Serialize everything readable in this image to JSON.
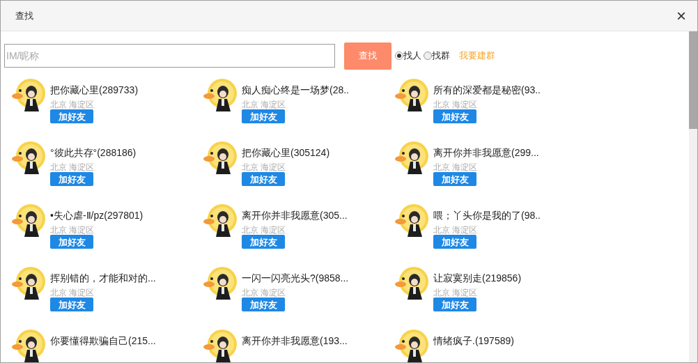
{
  "window": {
    "title": "查找",
    "close": "×"
  },
  "search": {
    "placeholder": "IM/昵称",
    "button": "查找"
  },
  "modes": [
    {
      "label": "找人",
      "selected": true
    },
    {
      "label": "找群",
      "selected": false
    }
  ],
  "create_group_link": "我要建群",
  "users": [
    {
      "name": "把你藏心里(289733)",
      "location": "北京 海淀区",
      "action": "加好友"
    },
    {
      "name": "痴人痴心终是一场梦(28..",
      "location": "北京 海淀区",
      "action": "加好友"
    },
    {
      "name": "所有的深爱都是秘密(93..",
      "location": "北京 海淀区",
      "action": "加好友"
    },
    {
      "name": "°彼此共存°(288186)",
      "location": "北京 海淀区",
      "action": "加好友"
    },
    {
      "name": "把你藏心里(305124)",
      "location": "北京 海淀区",
      "action": "加好友"
    },
    {
      "name": "离开你并非我愿意(299...",
      "location": "北京 海淀区",
      "action": "加好友"
    },
    {
      "name": "•失心虐-Ⅱ/pz(297801)",
      "location": "北京 海淀区",
      "action": "加好友"
    },
    {
      "name": "离开你并非我愿意(305...",
      "location": "北京 海淀区",
      "action": "加好友"
    },
    {
      "name": "喂；丫头你是我的了(98..",
      "location": "北京 海淀区",
      "action": "加好友"
    },
    {
      "name": "挥别错的，才能和对的...",
      "location": "北京 海淀区",
      "action": "加好友"
    },
    {
      "name": "一闪一闪亮光头?(9858...",
      "location": "北京 海淀区",
      "action": "加好友"
    },
    {
      "name": "让寂寞别走(219856)",
      "location": "北京 海淀区",
      "action": "加好友"
    },
    {
      "name": "你要懂得欺骗自己(215..."
    },
    {
      "name": "离开你并非我愿意(193..."
    },
    {
      "name": "情绪疯子.(197589)"
    }
  ]
}
